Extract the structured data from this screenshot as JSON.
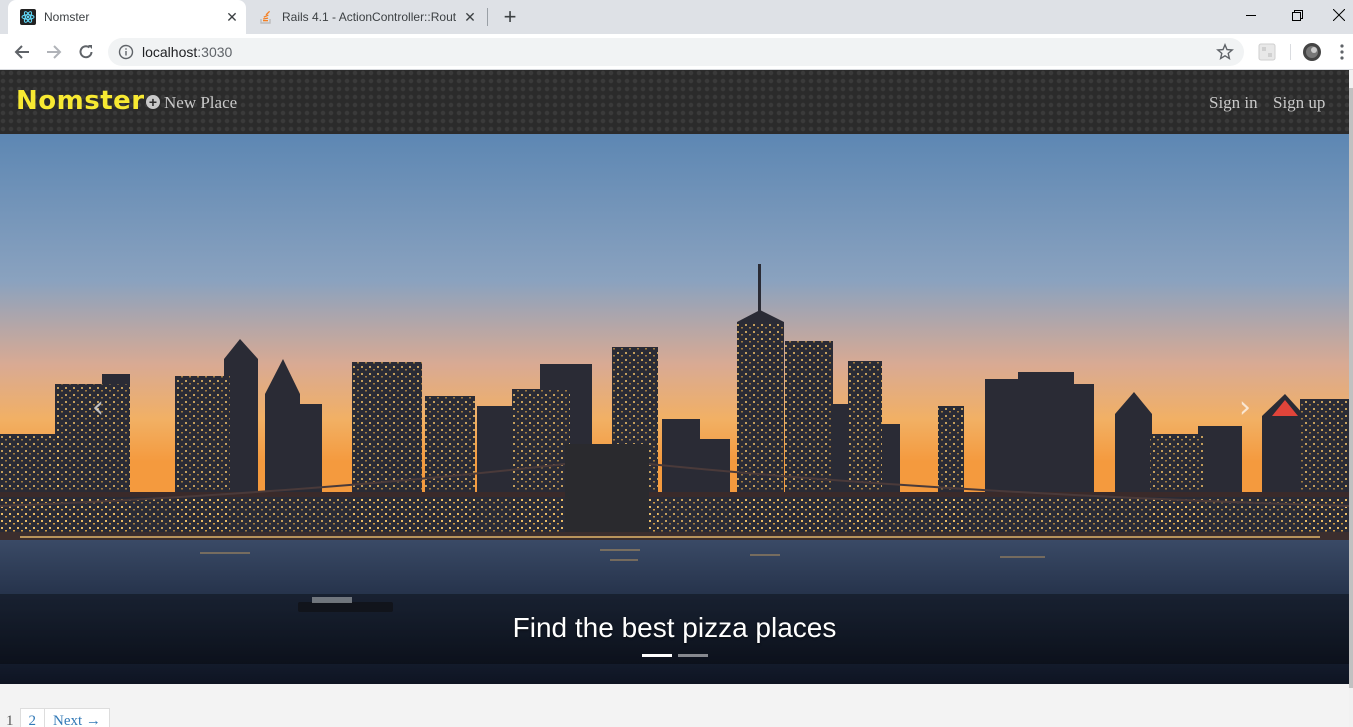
{
  "browser": {
    "tabs": [
      {
        "title": "Nomster",
        "active": true
      },
      {
        "title": "Rails 4.1 - ActionController::Rout",
        "active": false
      }
    ],
    "address": {
      "host": "localhost",
      "port": ":3030"
    }
  },
  "navbar": {
    "brand": "Nomster",
    "new_place": "New Place",
    "sign_in": "Sign in",
    "sign_up": "Sign up"
  },
  "carousel": {
    "caption": "Find the best pizza places",
    "slides": 2,
    "active_slide": 1
  },
  "pagination": {
    "pages": [
      "1",
      "2"
    ],
    "current": "1",
    "next": "Next →"
  },
  "colors": {
    "brand": "#f7e932",
    "navbar_bg": "#2b2b2b",
    "link": "#337ab7"
  }
}
